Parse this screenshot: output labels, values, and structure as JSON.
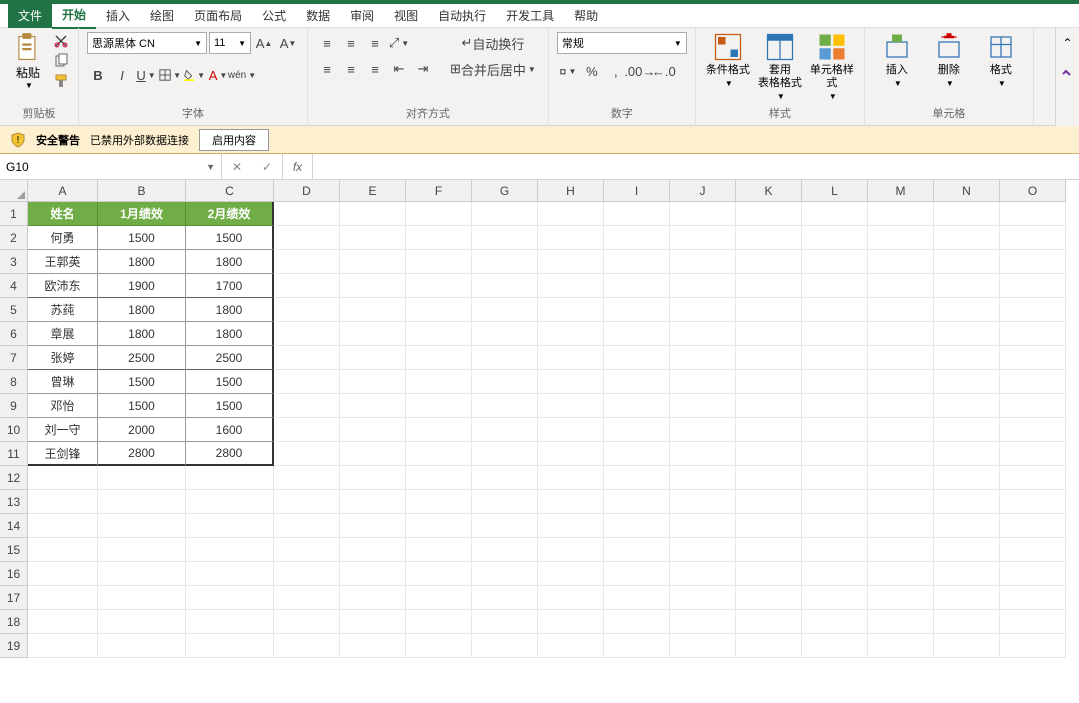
{
  "menu": {
    "file": "文件",
    "home": "开始",
    "insert": "插入",
    "draw": "绘图",
    "pagelayout": "页面布局",
    "formulas": "公式",
    "data": "数据",
    "review": "审阅",
    "view": "视图",
    "auto": "自动执行",
    "dev": "开发工具",
    "help": "帮助"
  },
  "ribbon": {
    "paste": "粘贴",
    "clipboard": "剪贴板",
    "fontname": "思源黑体 CN",
    "fontsize": "11",
    "font": "字体",
    "wrap": "自动换行",
    "merge": "合并后居中",
    "alignment": "对齐方式",
    "numfmt": "常规",
    "number": "数字",
    "condfmt": "条件格式",
    "tablefmt": "套用\n表格格式",
    "cellstyle": "单元格样式",
    "styles": "样式",
    "insert_btn": "插入",
    "delete_btn": "删除",
    "format_btn": "格式",
    "cells": "单元格"
  },
  "warn": {
    "title": "安全警告",
    "msg": "已禁用外部数据连接",
    "btn": "启用内容"
  },
  "namebox": "G10",
  "cols": [
    "A",
    "B",
    "C",
    "D",
    "E",
    "F",
    "G",
    "H",
    "I",
    "J",
    "K",
    "L",
    "M",
    "N",
    "O"
  ],
  "table": {
    "headers": [
      "姓名",
      "1月绩效",
      "2月绩效"
    ],
    "rows": [
      [
        "何勇",
        "1500",
        "1500"
      ],
      [
        "王郭英",
        "1800",
        "1800"
      ],
      [
        "欧沛东",
        "1900",
        "1700"
      ],
      [
        "苏莼",
        "1800",
        "1800"
      ],
      [
        "章展",
        "1800",
        "1800"
      ],
      [
        "张婷",
        "2500",
        "2500"
      ],
      [
        "曾琳",
        "1500",
        "1500"
      ],
      [
        "邓怡",
        "1500",
        "1500"
      ],
      [
        "刘一守",
        "2000",
        "1600"
      ],
      [
        "王剑锋",
        "2800",
        "2800"
      ]
    ]
  },
  "row_count": 19
}
